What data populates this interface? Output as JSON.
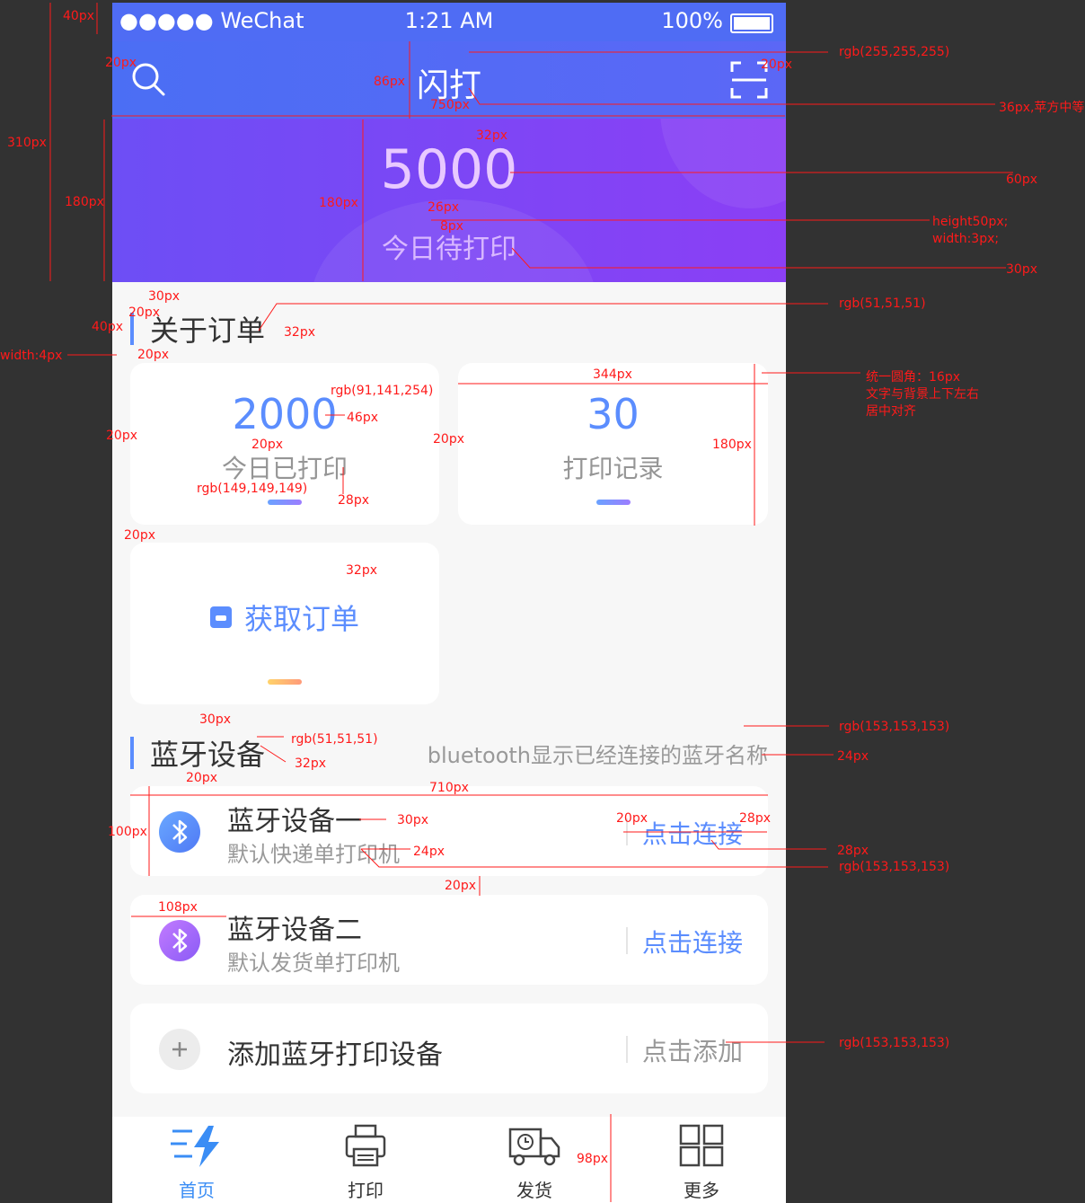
{
  "status": {
    "carrier": "●●●●● WeChat",
    "time": "1:21 AM",
    "battery": "100%"
  },
  "header": {
    "title": "闪打"
  },
  "hero": {
    "value": "5000",
    "label": "今日待打印"
  },
  "orders": {
    "title": "关于订单",
    "today_printed": {
      "value": "2000",
      "label": "今日已打印"
    },
    "records": {
      "value": "30",
      "label": "打印记录"
    },
    "fetch": {
      "label": "获取订单"
    }
  },
  "bluetooth": {
    "title": "蓝牙设备",
    "hint": "bluetooth显示已经连接的蓝牙名称",
    "devices": [
      {
        "name": "蓝牙设备一",
        "desc": "默认快递单打印机",
        "action": "点击连接"
      },
      {
        "name": "蓝牙设备二",
        "desc": "默认发货单打印机",
        "action": "点击连接"
      }
    ],
    "add": {
      "name": "添加蓝牙打印设备",
      "action": "点击添加"
    }
  },
  "tabs": [
    {
      "label": "首页",
      "icon": "lightning-icon"
    },
    {
      "label": "打印",
      "icon": "printer-icon"
    },
    {
      "label": "发货",
      "icon": "truck-icon"
    },
    {
      "label": "更多",
      "icon": "grid-icon"
    }
  ],
  "colors": {
    "primary": "#5b8dfe",
    "title_text": "#333333",
    "sub_text": "#999999",
    "label_text": "#959595"
  },
  "annotations": [
    "40px",
    "20px",
    "86px",
    "750px",
    "20px",
    "rgb(255,255,255)",
    "36px,苹方中等",
    "310px",
    "180px",
    "180px",
    "32px",
    "60px",
    "26px",
    "8px",
    "height50px;",
    "width:3px;",
    "30px",
    "30px",
    "rgb(51,51,51)",
    "20px",
    "40px",
    "32px",
    "width:4px",
    "20px",
    "344px",
    "统一圆角：16px",
    "文字与背景上下左右",
    "居中对齐",
    "rgb(91,141,254)",
    "46px",
    "20px",
    "20px",
    "20px",
    "180px",
    "rgb(149,149,149)",
    "28px",
    "20px",
    "32px",
    "30px",
    "rgb(51,51,51)",
    "32px",
    "rgb(153,153,153)",
    "24px",
    "20px",
    "710px",
    "100px",
    "30px",
    "20px",
    "28px",
    "24px",
    "28px",
    "rgb(153,153,153)",
    "20px",
    "108px",
    "rgb(153,153,153)",
    "98px"
  ]
}
